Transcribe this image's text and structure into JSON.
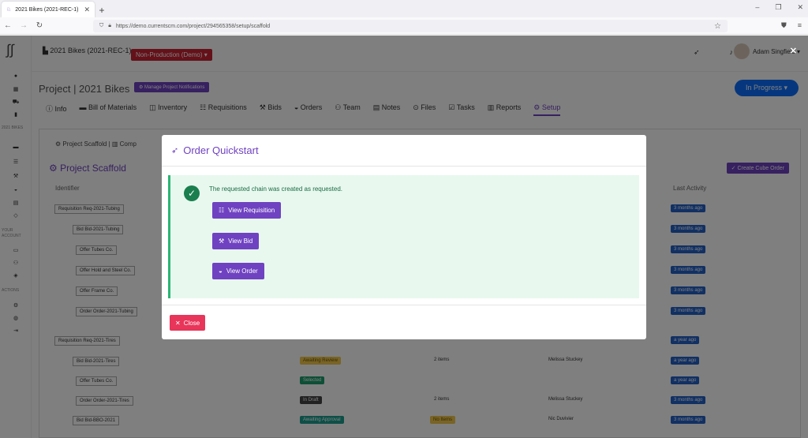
{
  "browser": {
    "tab_title": "2021 Bikes (2021-REC-1)",
    "new_tab": "+",
    "url": "https://demo.currentscm.com/project/294565358/setup/scaffold",
    "win_controls": [
      "–",
      "❐",
      "✕"
    ]
  },
  "topbar": {
    "project_label": "2021 Bikes (2021-REC-1)",
    "production_button": "Non-Production (Demo) ▾",
    "user_name": "Adam Singfield ▾"
  },
  "sidebar": {
    "sections": [
      "2021 BIKES",
      "YOUR ACCOUNT",
      "ACTIONS"
    ]
  },
  "project": {
    "title": "Project | 2021 Bikes",
    "manage_button": "⚙ Manage Project Notifications",
    "status": "In Progress ▾"
  },
  "tabs": [
    "Info",
    "Bill of Materials",
    "Inventory",
    "Requisitions",
    "Bids",
    "Orders",
    "Team",
    "Notes",
    "Files",
    "Tasks",
    "Reports",
    "Setup"
  ],
  "scaffold": {
    "breadcrumb_1": "Project Scaffold",
    "breadcrumb_2": "Comp",
    "title": "Project Scaffold",
    "create_button": "✓ Create Cube Order",
    "col_identifier": "Identifier",
    "col_last_activity": "Last Activity",
    "rows": [
      {
        "label": "Requisition Req-2021-Tubing",
        "activity": "3 months ago"
      },
      {
        "label": "Bid Bid-2021-Tubing",
        "activity": "3 months ago"
      },
      {
        "label": "Offer Tubes Co.",
        "activity": "3 months ago"
      },
      {
        "label": "Offer Hold and Steel Co.",
        "activity": "3 months ago"
      },
      {
        "label": "Offer Frame Co.",
        "activity": "3 months ago"
      },
      {
        "label": "Order Order-2021-Tubing",
        "activity": "3 months ago"
      },
      {
        "label": "Requisition Req-2021-Tires",
        "activity": "a year ago"
      },
      {
        "label": "Bid Bid-2021-Tires",
        "status": "Awaiting Review",
        "qty": "2 items",
        "person": "Melissa Stuckey",
        "activity": "a year ago"
      },
      {
        "label": "Offer Tubes Co.",
        "status": "Selected",
        "activity": "a year ago"
      },
      {
        "label": "Order Order-2021-Tires",
        "status": "In Draft",
        "qty": "2 items",
        "person": "Melissa Stuckey",
        "activity": "3 months ago"
      },
      {
        "label": "Bid Bid-BBO-2021",
        "status": "Awaiting Approval",
        "status2": "No Items",
        "person": "Nic Duvivier",
        "activity": "3 months ago"
      }
    ]
  },
  "modal": {
    "title": "Order Quickstart",
    "message": "The requested chain was created as requested.",
    "view_requisition": "View Requisition",
    "view_bid": "View Bid",
    "view_order": "View Order",
    "close": "Close"
  },
  "colors": {
    "accent": "#6f42c1",
    "success": "#1b7e4e",
    "danger": "#e8355a",
    "info": "#2260c6"
  }
}
